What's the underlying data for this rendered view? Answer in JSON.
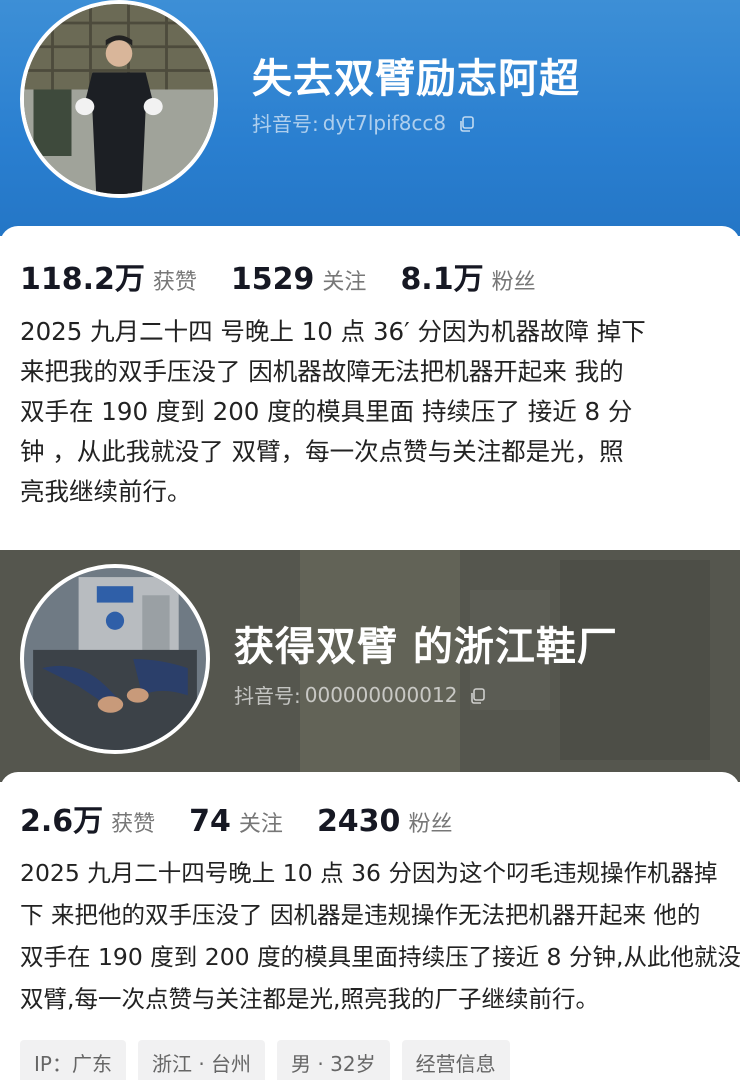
{
  "profiles": [
    {
      "nickname": "失去双臂励志阿超",
      "id_label": "抖音号:",
      "id_value": "dyt7lpif8cc8",
      "stats": [
        {
          "value": "118.2万",
          "label": "获赞"
        },
        {
          "value": "1529",
          "label": "关注"
        },
        {
          "value": "8.1万",
          "label": "粉丝"
        }
      ],
      "bio_lines": [
        "2025 九月二十四 号晚上 10 点 36′ 分因为机器故障 掉下",
        "来把我的双手压没了 因机器故障无法把机器开起来 我的",
        "双手在 190 度到 200 度的模具里面 持续压了 接近 8 分",
        "钟 ，从此我就没了 双臂，每一次点赞与关注都是光，照",
        "亮我继续前行。"
      ],
      "colors": {
        "banner": "#2a7fd0"
      }
    },
    {
      "nickname": "获得双臂 的浙江鞋厂",
      "id_label": "抖音号:",
      "id_value": "000000000012",
      "stats": [
        {
          "value": "2.6万",
          "label": "获赞"
        },
        {
          "value": "74",
          "label": "关注"
        },
        {
          "value": "2430",
          "label": "粉丝"
        }
      ],
      "bio_lines": [
        "2025 九月二十四号晚上 10 点 36 分因为这个叼毛违规操作机器掉",
        "下 来把他的双手压没了 因机器是违规操作无法把机器开起来 他的",
        "双手在 190 度到 200 度的模具里面持续压了接近 8 分钟,从此他就没了",
        "双臂,每一次点赞与关注都是光,照亮我的厂子继续前行。"
      ],
      "tags": [
        "IP：广东",
        "浙江 · 台州",
        "男 · 32岁",
        "经营信息"
      ],
      "colors": {
        "banner": "#55564e"
      }
    }
  ],
  "icons": [
    "copy-icon"
  ]
}
